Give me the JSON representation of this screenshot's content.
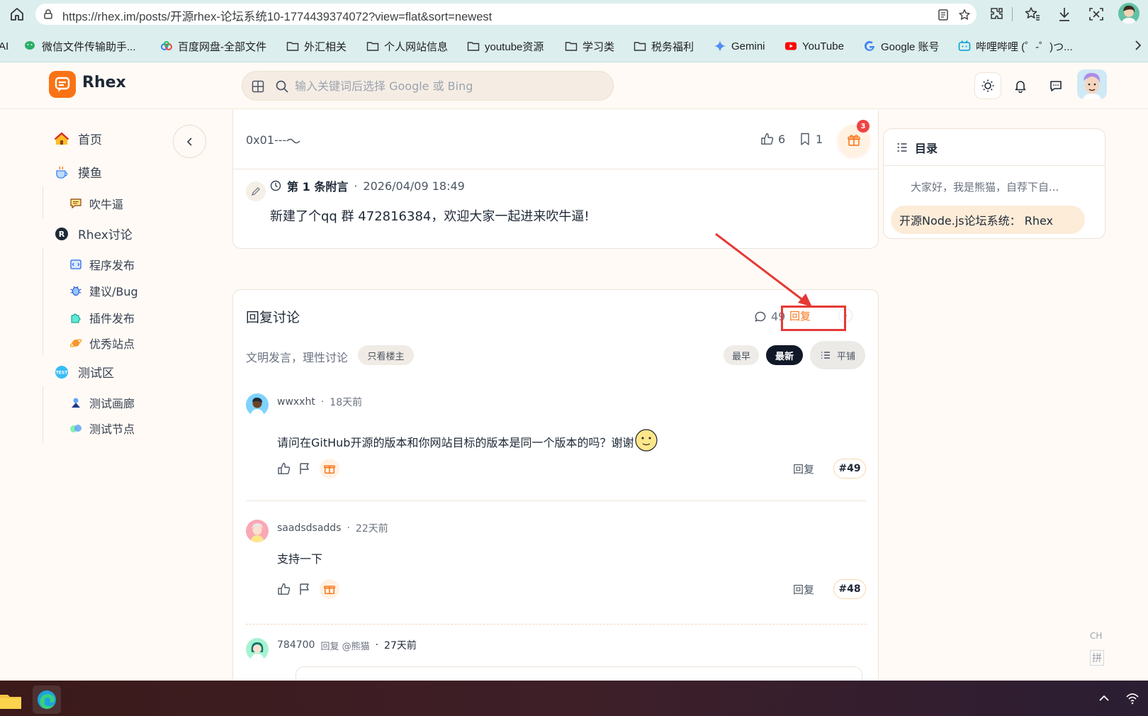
{
  "browser": {
    "url": "https://rhex.im/posts/开源rhex-论坛系统10-1774439374072?view=flat&sort=newest",
    "bookmarks": [
      {
        "label": "AI",
        "icon": "ai-icon"
      },
      {
        "label": "微信文件传输助手...",
        "icon": "wechat-icon"
      },
      {
        "label": "百度网盘-全部文件",
        "icon": "baidu-netdisk-icon"
      },
      {
        "label": "外汇相关",
        "icon": "folder-icon"
      },
      {
        "label": "个人网站信息",
        "icon": "folder-icon"
      },
      {
        "label": "youtube资源",
        "icon": "folder-icon"
      },
      {
        "label": "学习类",
        "icon": "folder-icon"
      },
      {
        "label": "税务福利",
        "icon": "folder-icon"
      },
      {
        "label": "Gemini",
        "icon": "gemini-icon"
      },
      {
        "label": "YouTube",
        "icon": "youtube-icon"
      },
      {
        "label": "Google 账号",
        "icon": "google-icon"
      },
      {
        "label": "哔哩哔哩 (゜-゜)つ...",
        "icon": "bilibili-icon"
      }
    ]
  },
  "site": {
    "name": "Rhex",
    "search_placeholder": "输入关键词后选择 Google 或 Bing"
  },
  "sidebar": {
    "items": [
      {
        "label": "首页",
        "icon": "house-icon"
      },
      {
        "label": "摸鱼",
        "icon": "coffee-cup-icon"
      },
      {
        "label": "吹牛逼",
        "icon": "speech-bubble-icon"
      },
      {
        "label": "Rhex讨论",
        "icon": "r-logo-icon"
      },
      {
        "label": "程序发布",
        "icon": "code-window-icon"
      },
      {
        "label": "建议/Bug",
        "icon": "bug-icon"
      },
      {
        "label": "插件发布",
        "icon": "puzzle-icon"
      },
      {
        "label": "优秀站点",
        "icon": "planet-icon"
      },
      {
        "label": "测试区",
        "icon": "test-badge-icon"
      },
      {
        "label": "测试画廊",
        "icon": "gallery-icon"
      },
      {
        "label": "测试节点",
        "icon": "node-icon"
      }
    ]
  },
  "post": {
    "title_fragment": "0x01---",
    "likes": "6",
    "bookmarks": "1",
    "gift_badge": "3",
    "append": {
      "prefix": "第",
      "number": "1",
      "suffix": "条附言",
      "separator": "·",
      "time": "2026/04/09 18:49",
      "body": "新建了个qq 群 472816384，欢迎大家一起进来吹牛逼!"
    }
  },
  "replies": {
    "title": "回复讨论",
    "count": "49",
    "reply_label": "回复",
    "subtitle": "文明发言，理性讨论",
    "owner_only": "只看楼主",
    "sort_oldest": "最早",
    "sort_newest": "最新",
    "view_flat": "平铺",
    "comments": [
      {
        "user": "wwxxht",
        "sep": "·",
        "time": "18天前",
        "body": "请问在GitHub开源的版本和你网站目标的版本是同一个版本的吗？谢谢",
        "reply": "回复",
        "floor": "#49"
      },
      {
        "user": "saadsdsadds",
        "sep": "·",
        "time": "22天前",
        "body": "支持一下",
        "reply": "回复",
        "floor": "#48"
      },
      {
        "user": "784700",
        "reply_to": "回复 @熊猫",
        "sep": "·",
        "time": "27天前"
      }
    ]
  },
  "toc": {
    "title": "目录",
    "items": [
      "大家好，我是熊猫，自荐下自...",
      "开源Node.js论坛系统： Rhex"
    ]
  },
  "ime": {
    "lang": "CH",
    "mode": "拼"
  }
}
